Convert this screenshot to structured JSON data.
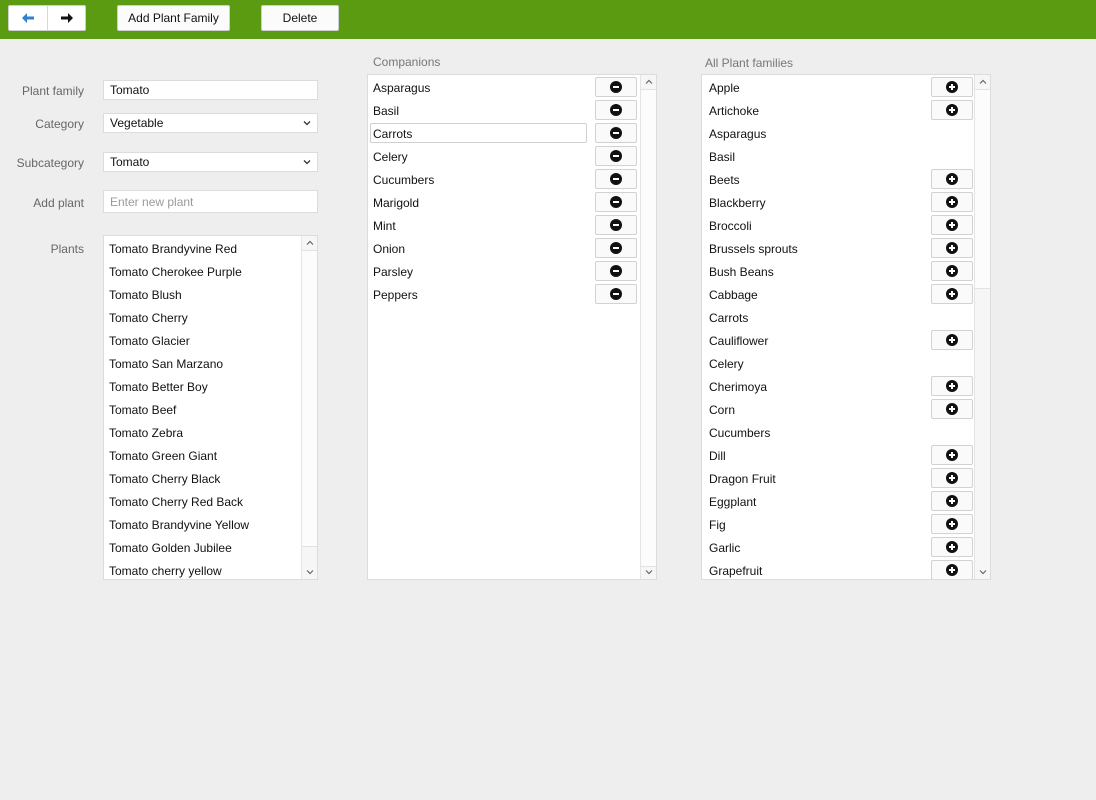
{
  "toolbar": {
    "back_icon": "arrow-left-icon",
    "forward_icon": "arrow-right-icon",
    "add_label": "Add Plant Family",
    "delete_label": "Delete",
    "accent": "#5b9b12"
  },
  "form": {
    "plant_family_label": "Plant family",
    "plant_family_value": "Tomato",
    "category_label": "Category",
    "category_value": "Vegetable",
    "subcategory_label": "Subcategory",
    "subcategory_value": "Tomato",
    "add_plant_label": "Add plant",
    "add_plant_placeholder": "Enter new plant",
    "plants_label": "Plants",
    "plants": [
      "Tomato Brandyvine Red",
      "Tomato Cherokee Purple",
      "Tomato Blush",
      "Tomato Cherry",
      "Tomato Glacier",
      "Tomato San Marzano",
      "Tomato Better Boy",
      "Tomato Beef",
      "Tomato Zebra",
      "Tomato Green Giant",
      "Tomato Cherry Black",
      "Tomato Cherry Red Back",
      "Tomato Brandyvine Yellow",
      "Tomato Golden Jubilee",
      "Tomato cherry yellow"
    ]
  },
  "companions": {
    "title": "Companions",
    "items": [
      "Asparagus",
      "Basil",
      "Carrots",
      "Celery",
      "Cucumbers",
      "Marigold",
      "Mint",
      "Onion",
      "Parsley",
      "Peppers"
    ],
    "selected": "Carrots",
    "remove_icon": "minus-circle-icon"
  },
  "all_families": {
    "title": "All Plant families",
    "add_icon": "plus-circle-icon",
    "items": [
      {
        "name": "Apple",
        "addable": true
      },
      {
        "name": "Artichoke",
        "addable": true
      },
      {
        "name": "Asparagus",
        "addable": false
      },
      {
        "name": "Basil",
        "addable": false
      },
      {
        "name": "Beets",
        "addable": true
      },
      {
        "name": "Blackberry",
        "addable": true
      },
      {
        "name": "Broccoli",
        "addable": true
      },
      {
        "name": "Brussels sprouts",
        "addable": true
      },
      {
        "name": "Bush Beans",
        "addable": true
      },
      {
        "name": "Cabbage",
        "addable": true
      },
      {
        "name": "Carrots",
        "addable": false
      },
      {
        "name": "Cauliflower",
        "addable": true
      },
      {
        "name": "Celery",
        "addable": false
      },
      {
        "name": "Cherimoya",
        "addable": true
      },
      {
        "name": "Corn",
        "addable": true
      },
      {
        "name": "Cucumbers",
        "addable": false
      },
      {
        "name": "Dill",
        "addable": true
      },
      {
        "name": "Dragon Fruit",
        "addable": true
      },
      {
        "name": "Eggplant",
        "addable": true
      },
      {
        "name": "Fig",
        "addable": true
      },
      {
        "name": "Garlic",
        "addable": true
      },
      {
        "name": "Grapefruit",
        "addable": true
      }
    ]
  }
}
